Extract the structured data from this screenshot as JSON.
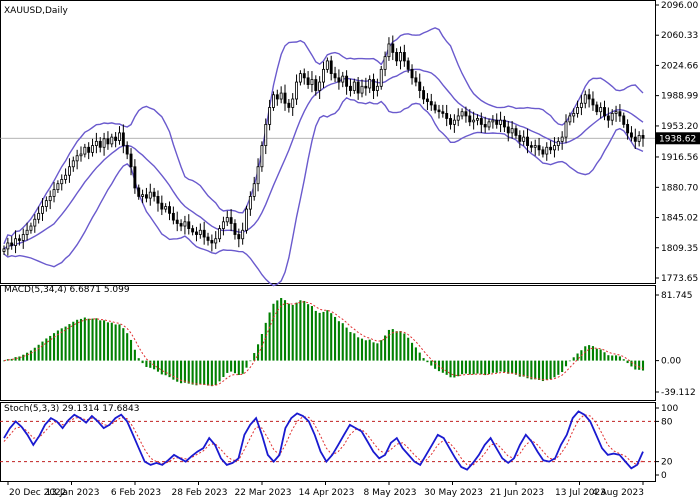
{
  "chart_data": [
    {
      "type": "candlestick",
      "title": "XAUUSD,Daily",
      "x_tick_labels": [
        "20 Dec 2022",
        "13 Jan 2023",
        "6 Feb 2023",
        "28 Feb 2023",
        "22 Mar 2023",
        "14 Apr 2023",
        "8 May 2023",
        "30 May 2023",
        "21 Jun 2023",
        "13 Jul 2023",
        "4 Aug 2023"
      ],
      "y_tick_labels": [
        "2096.00",
        "2060.33",
        "2024.66",
        "1988.99",
        "1953.20",
        "1916.56",
        "1880.70",
        "1845.02",
        "1809.35",
        "1773.65"
      ],
      "ylim": [
        1773.65,
        2096.0
      ],
      "current_price": 1938.62,
      "current_price_label": "1938.62",
      "close_sketch": [
        1808,
        1815,
        1812,
        1820,
        1818,
        1825,
        1830,
        1835,
        1843,
        1850,
        1858,
        1865,
        1870,
        1878,
        1885,
        1890,
        1895,
        1905,
        1912,
        1918,
        1920,
        1928,
        1922,
        1930,
        1935,
        1928,
        1938,
        1932,
        1940,
        1936,
        1945,
        1930,
        1920,
        1905,
        1880,
        1870,
        1872,
        1868,
        1875,
        1870,
        1862,
        1855,
        1858,
        1850,
        1842,
        1838,
        1835,
        1840,
        1832,
        1828,
        1825,
        1830,
        1822,
        1818,
        1815,
        1820,
        1832,
        1840,
        1845,
        1838,
        1825,
        1820,
        1830,
        1855,
        1870,
        1885,
        1905,
        1930,
        1955,
        1975,
        1990,
        1985,
        1992,
        1980,
        1975,
        1985,
        2005,
        2015,
        2010,
        2002,
        2008,
        1995,
        2005,
        2020,
        2030,
        2015,
        2010,
        2005,
        2012,
        2000,
        1995,
        2005,
        1992,
        2000,
        1998,
        2008,
        1995,
        2000,
        2020,
        2035,
        2050,
        2040,
        2030,
        2040,
        2030,
        2020,
        2010,
        2005,
        1995,
        1985,
        1982,
        1978,
        1972,
        1970,
        1968,
        1962,
        1955,
        1960,
        1965,
        1970,
        1965,
        1958,
        1960,
        1962,
        1955,
        1952,
        1958,
        1960,
        1955,
        1960,
        1952,
        1945,
        1950,
        1942,
        1935,
        1940,
        1930,
        1928,
        1930,
        1925,
        1920,
        1928,
        1925,
        1930,
        1935,
        1940,
        1958,
        1965,
        1968,
        1975,
        1980,
        1990,
        1985,
        1978,
        1970,
        1975,
        1965,
        1960,
        1968,
        1970,
        1965,
        1955,
        1945,
        1940,
        1935,
        1942,
        1938.62
      ]
    },
    {
      "type": "bar",
      "title": "MACD(5,34,4) 6.6871 5.099",
      "y_tick_labels": [
        "81.745",
        "0.00",
        "-39.112"
      ],
      "ylim": [
        -39.112,
        81.745
      ],
      "sketch": "histogram of MACD main values (green bars) with signal line (red dotted)"
    },
    {
      "type": "line",
      "title": "Stoch(5,3,3) 29.1314 17.6843",
      "y_tick_labels": [
        "100",
        "80",
        "20",
        "0"
      ],
      "ylim": [
        0,
        100
      ],
      "levels": [
        80,
        20
      ],
      "main_sketch": [
        55,
        70,
        80,
        72,
        60,
        45,
        58,
        75,
        85,
        80,
        70,
        82,
        90,
        85,
        78,
        88,
        80,
        70,
        75,
        85,
        90,
        80,
        60,
        40,
        20,
        15,
        18,
        15,
        22,
        30,
        25,
        20,
        28,
        35,
        40,
        55,
        45,
        25,
        15,
        18,
        25,
        60,
        75,
        85,
        60,
        30,
        20,
        30,
        70,
        85,
        92,
        88,
        80,
        60,
        35,
        20,
        30,
        45,
        60,
        75,
        70,
        65,
        50,
        35,
        25,
        30,
        48,
        55,
        40,
        30,
        20,
        15,
        30,
        45,
        60,
        55,
        40,
        25,
        12,
        8,
        18,
        30,
        45,
        55,
        40,
        25,
        18,
        25,
        45,
        60,
        50,
        35,
        22,
        20,
        25,
        45,
        60,
        85,
        95,
        90,
        80,
        60,
        40,
        30,
        32,
        30,
        20,
        10,
        15,
        35
      ],
      "signal_sketch": [
        50,
        60,
        70,
        72,
        65,
        55,
        56,
        65,
        75,
        80,
        75,
        78,
        85,
        86,
        82,
        85,
        83,
        75,
        74,
        80,
        86,
        84,
        72,
        55,
        38,
        25,
        20,
        17,
        19,
        25,
        26,
        24,
        26,
        31,
        36,
        45,
        47,
        38,
        28,
        22,
        22,
        38,
        55,
        72,
        70,
        55,
        38,
        30,
        45,
        65,
        80,
        87,
        86,
        75,
        58,
        40,
        30,
        35,
        45,
        60,
        68,
        68,
        60,
        48,
        37,
        32,
        38,
        46,
        48,
        40,
        30,
        22,
        22,
        32,
        45,
        52,
        48,
        38,
        25,
        15,
        15,
        22,
        32,
        45,
        47,
        38,
        28,
        25,
        32,
        45,
        52,
        45,
        35,
        25,
        23,
        32,
        45,
        65,
        82,
        90,
        88,
        78,
        62,
        45,
        36,
        32,
        28,
        20,
        15,
        22
      ]
    }
  ]
}
